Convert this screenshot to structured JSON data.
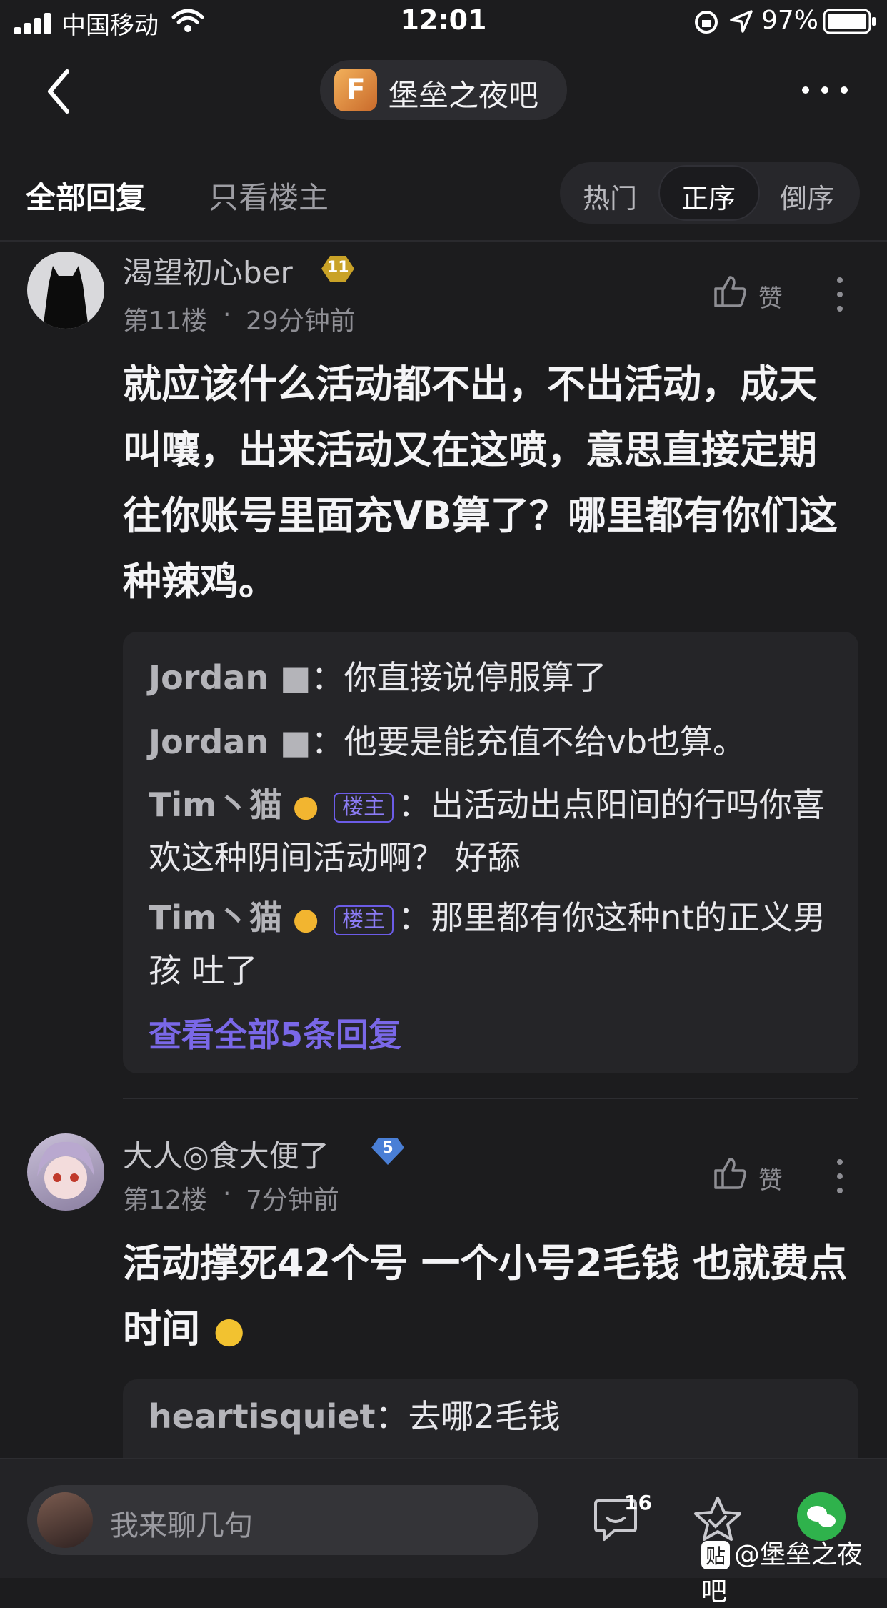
{
  "status_bar": {
    "carrier": "中国移动",
    "time": "12:01",
    "battery": "97%"
  },
  "nav": {
    "forum_title": "堡垒之夜吧",
    "logo_letter": "F"
  },
  "tabs": {
    "all_replies": "全部回复",
    "only_host": "只看楼主",
    "sort": [
      "热门",
      "正序",
      "倒序"
    ],
    "active_sort": "正序"
  },
  "posts": [
    {
      "username": "渴望初心ber",
      "level": "11",
      "floor": "第11楼",
      "time": "29分钟前",
      "like_label": "赞",
      "content": "就应该什么活动都不出，不出活动，成天叫嚷，出来活动又在这喷，意思直接定期往你账号里面充VB算了？哪里都有你们这种辣鸡。",
      "replies": [
        {
          "name": "Jordan ■",
          "sep": "：",
          "text": "你直接说停服算了"
        },
        {
          "name": "Jordan ■",
          "sep": "：",
          "text": "他要是能充值不给vb也算。"
        },
        {
          "name": "Tim丶猫",
          "host_tag": "楼主",
          "sep": "：",
          "text": "出活动出点阳间的行吗你喜欢这种阴间活动啊？ 好舔"
        },
        {
          "name": "Tim丶猫",
          "host_tag": "楼主",
          "sep": "：",
          "text": "那里都有你这种nt的正义男孩 吐了"
        }
      ],
      "view_all": "查看全部5条回复"
    },
    {
      "username": "大人◎食大便了",
      "level": "5",
      "floor": "第12楼",
      "time": "7分钟前",
      "like_label": "赞",
      "content": "活动撑死42个号 一个小号2毛钱 也就费点时间",
      "replies": [
        {
          "name": "heartisquiet",
          "sep": "：",
          "text": "去哪2毛钱"
        }
      ]
    }
  ],
  "bottom_bar": {
    "input_placeholder": "我来聊几句",
    "comment_count": "16",
    "watermark": "@堡垒之夜吧",
    "watermark_badge": "贴"
  },
  "colors": {
    "background": "#1c1c1e",
    "accent": "#7a68e8",
    "host_tag": "#6c5ce7",
    "wechat": "#2fb24c"
  }
}
